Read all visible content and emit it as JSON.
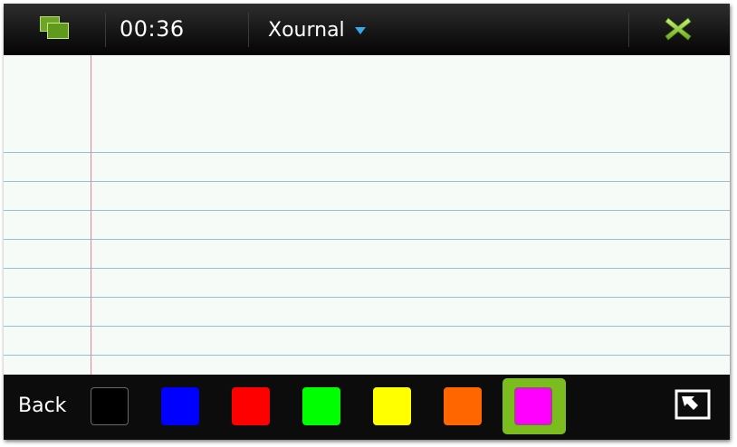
{
  "topbar": {
    "switcher_icon": "task-switcher-icon",
    "clock": "00:36",
    "app_title": "Xournal",
    "dropdown_icon": "chevron-down-icon",
    "close_icon": "close-icon",
    "accent_color": "#7bbd1e",
    "dropdown_color": "#39a8e8"
  },
  "paper": {
    "background": "#f6fbf7",
    "rule_color": "#8fc0e2",
    "margin_color": "#ef7fa4"
  },
  "bottombar": {
    "back_label": "Back",
    "colors": [
      {
        "name": "black",
        "hex": "#000000",
        "selected": false
      },
      {
        "name": "blue",
        "hex": "#0000ff",
        "selected": false
      },
      {
        "name": "red",
        "hex": "#ff0000",
        "selected": false
      },
      {
        "name": "green",
        "hex": "#00ff00",
        "selected": false
      },
      {
        "name": "yellow",
        "hex": "#ffff00",
        "selected": false
      },
      {
        "name": "orange",
        "hex": "#ff6600",
        "selected": false
      },
      {
        "name": "magenta",
        "hex": "#ff00ff",
        "selected": true
      }
    ],
    "fullscreen_icon": "fullscreen-toggle-icon"
  }
}
